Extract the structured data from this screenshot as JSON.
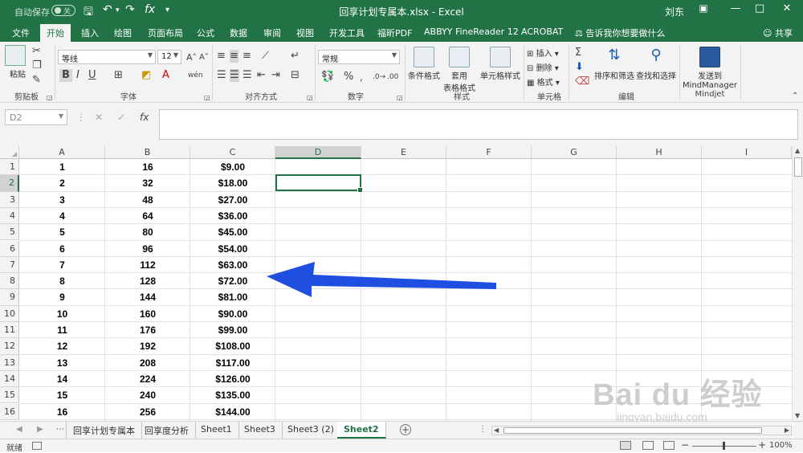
{
  "titlebar": {
    "autosave_label": "自动保存",
    "autosave_state": "关",
    "title": "回享计划专属本.xlsx  -  Excel",
    "user": "刘东"
  },
  "ribbon_tabs": [
    "文件",
    "开始",
    "插入",
    "绘图",
    "页面布局",
    "公式",
    "数据",
    "审阅",
    "视图",
    "开发工具",
    "福昕PDF",
    "ABBYY FineReader 12",
    "ACROBAT"
  ],
  "active_tab": "开始",
  "tell_me": "告诉我你想要做什么",
  "share": "共享",
  "ribbon": {
    "paste": "粘贴",
    "font_name": "等线",
    "font_size": "12",
    "number_format": "常规",
    "cond_format": "条件格式",
    "table_format_1": "套用",
    "table_format_2": "表格格式",
    "cell_styles": "单元格样式",
    "insert": "插入",
    "delete": "删除",
    "format": "格式",
    "sort_filter": "排序和筛选",
    "find_select": "查找和选择",
    "send_to_1": "发送到",
    "send_to_2": "MindManager",
    "groups": {
      "clipboard": "剪贴板",
      "font": "字体",
      "alignment": "对齐方式",
      "number": "数字",
      "styles": "样式",
      "cells": "单元格",
      "editing": "编辑",
      "mindjet": "Mindjet"
    }
  },
  "formula_bar": {
    "name_box": "D2",
    "formula": ""
  },
  "columns": [
    "A",
    "B",
    "C",
    "D",
    "E",
    "F",
    "G",
    "H",
    "I"
  ],
  "selected_column": "D",
  "selected_cell": "D2",
  "rows": [
    {
      "n": "1",
      "a": "1",
      "b": "16",
      "c": "$9.00"
    },
    {
      "n": "2",
      "a": "2",
      "b": "32",
      "c": "$18.00"
    },
    {
      "n": "3",
      "a": "3",
      "b": "48",
      "c": "$27.00"
    },
    {
      "n": "4",
      "a": "4",
      "b": "64",
      "c": "$36.00"
    },
    {
      "n": "5",
      "a": "5",
      "b": "80",
      "c": "$45.00"
    },
    {
      "n": "6",
      "a": "6",
      "b": "96",
      "c": "$54.00"
    },
    {
      "n": "7",
      "a": "7",
      "b": "112",
      "c": "$63.00"
    },
    {
      "n": "8",
      "a": "8",
      "b": "128",
      "c": "$72.00"
    },
    {
      "n": "9",
      "a": "9",
      "b": "144",
      "c": "$81.00"
    },
    {
      "n": "10",
      "a": "10",
      "b": "160",
      "c": "$90.00"
    },
    {
      "n": "11",
      "a": "11",
      "b": "176",
      "c": "$99.00"
    },
    {
      "n": "12",
      "a": "12",
      "b": "192",
      "c": "$108.00"
    },
    {
      "n": "13",
      "a": "13",
      "b": "208",
      "c": "$117.00"
    },
    {
      "n": "14",
      "a": "14",
      "b": "224",
      "c": "$126.00"
    },
    {
      "n": "15",
      "a": "15",
      "b": "240",
      "c": "$135.00"
    },
    {
      "n": "16",
      "a": "16",
      "b": "256",
      "c": "$144.00"
    }
  ],
  "sheet_tabs": [
    "回享计划专属本",
    "回享度分析",
    "Sheet1",
    "Sheet3",
    "Sheet3 (2)",
    "Sheet2"
  ],
  "active_sheet": "Sheet2",
  "status": {
    "ready": "就绪",
    "zoom": "100%"
  },
  "watermark": {
    "brand": "Bai du 经验",
    "url": "jingyan.baidu.com"
  },
  "colors": {
    "excel_green": "#217346",
    "arrow_blue": "#1f4fe0"
  }
}
